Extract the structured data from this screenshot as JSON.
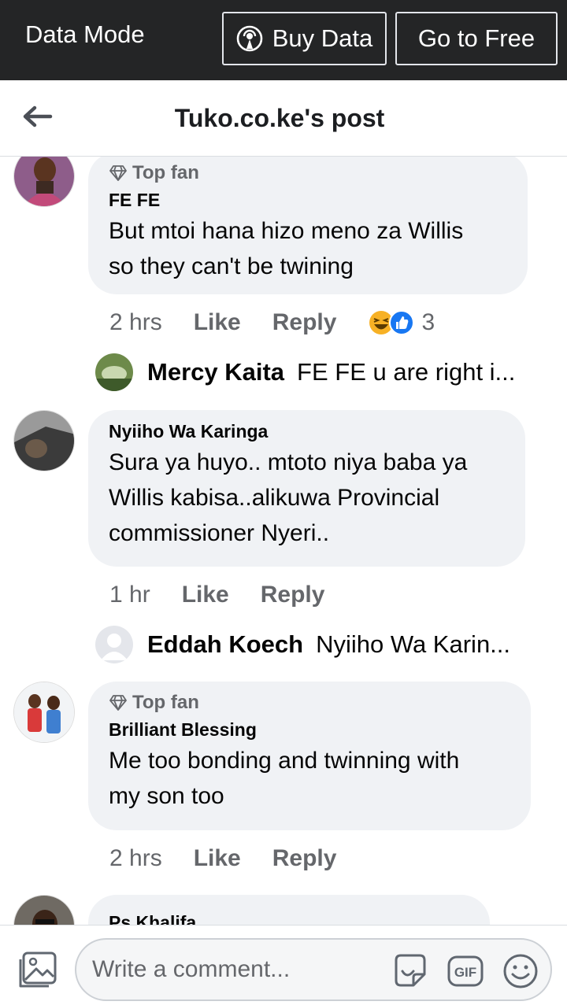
{
  "data_bar": {
    "label": "Data Mode",
    "buy_label": "Buy Data",
    "free_label": "Go to Free"
  },
  "header": {
    "title": "Tuko.co.ke's post"
  },
  "comments": [
    {
      "badge": "Top fan",
      "author": "FE FE",
      "lines": [
        "But mtoi hana hizo meno za Willis",
        "so they can't  be twining"
      ],
      "time": "2 hrs",
      "like": "Like",
      "reply": "Reply",
      "reaction_count": "3",
      "reply_preview": {
        "name": "Mercy Kaita",
        "text": "FE FE u are right i..."
      }
    },
    {
      "author": "Nyiiho Wa Karinga",
      "lines": [
        "Sura ya huyo.. mtoto niya baba ya",
        "Willis kabisa..alikuwa Provincial",
        "commissioner Nyeri.."
      ],
      "time": "1 hr",
      "like": "Like",
      "reply": "Reply",
      "reply_preview": {
        "name": "Eddah Koech",
        "text": "Nyiiho Wa Karin..."
      }
    },
    {
      "badge": "Top fan",
      "author": "Brilliant Blessing",
      "lines": [
        "Me too bonding and twinning with",
        "my son too"
      ],
      "time": "2 hrs",
      "like": "Like",
      "reply": "Reply"
    },
    {
      "author": "Ps Khalifa"
    }
  ],
  "composer": {
    "placeholder": "Write a comment..."
  },
  "colors": {
    "data_bar_bg": "#242526",
    "bubble_bg": "#f0f2f5",
    "secondary_text": "#65676b",
    "like_blue": "#1877f2",
    "haha_yellow": "#f7b125"
  },
  "icons": [
    "back-arrow-icon",
    "broadcast-icon",
    "diamond-icon",
    "haha-reaction-icon",
    "like-reaction-icon",
    "photo-icon",
    "sticker-icon",
    "gif-icon",
    "emoji-icon"
  ]
}
